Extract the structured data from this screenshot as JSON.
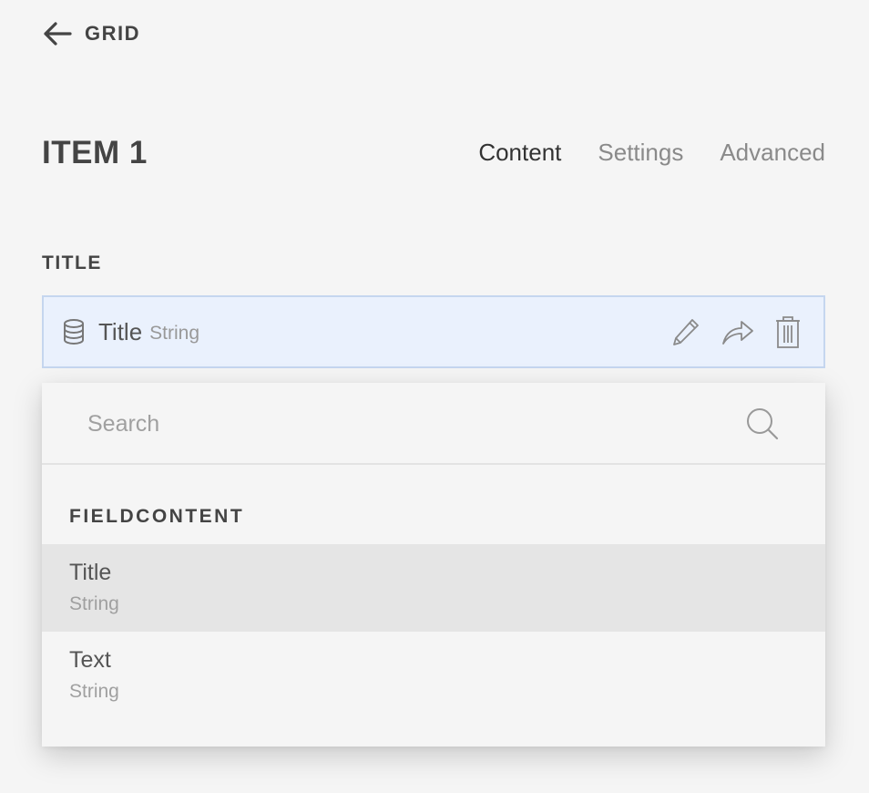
{
  "header": {
    "back_label": "GRID",
    "back_icon": "arrow-left-icon"
  },
  "page": {
    "title": "ITEM 1"
  },
  "tabs": [
    {
      "label": "Content",
      "active": true
    },
    {
      "label": "Settings",
      "active": false
    },
    {
      "label": "Advanced",
      "active": false
    }
  ],
  "field_section": {
    "label": "TITLE",
    "field": {
      "icon": "database-icon",
      "name": "Title",
      "type": "String",
      "actions": [
        "pencil-icon",
        "share-arrow-icon",
        "trash-icon"
      ]
    }
  },
  "dropdown": {
    "search_placeholder": "Search",
    "search_value": "",
    "group_label": "FIELDCONTENT",
    "items": [
      {
        "name": "Title",
        "type": "String",
        "selected": true
      },
      {
        "name": "Text",
        "type": "String",
        "selected": false
      }
    ]
  },
  "colors": {
    "background": "#f5f5f5",
    "field_background": "#eaf1fd",
    "field_border": "#c5d6ef",
    "selected_item": "#e5e5e5",
    "text_primary": "#444444",
    "text_muted": "#999999"
  }
}
